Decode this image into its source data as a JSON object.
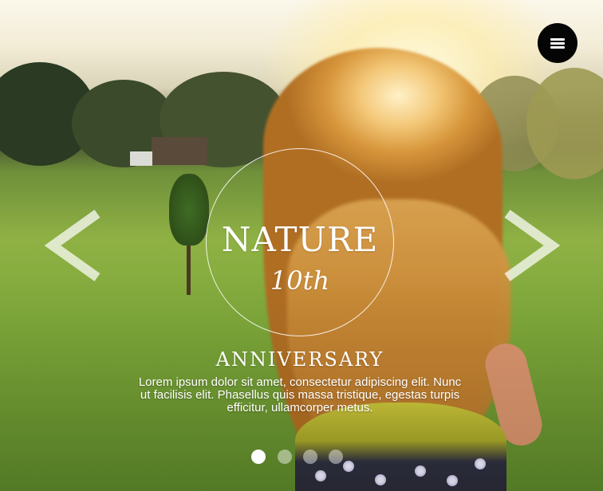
{
  "hero": {
    "title": "NATURE",
    "edition": "10th",
    "subtitle": "ANNIVERSARY",
    "description": "Lorem ipsum dolor sit amet, consectetur adipiscing elit. Nunc ut facilisis elit. Phasellus quis massa tristique, egestas turpis efficitur, ullamcorper metus."
  },
  "menu": {
    "icon": "hamburger-menu-icon"
  },
  "navigation": {
    "prev_icon": "chevron-left-icon",
    "next_icon": "chevron-right-icon"
  },
  "pagination": {
    "total_slides": 4,
    "active_slide": 1
  },
  "colors": {
    "menu_button": "#050505",
    "text": "#ffffff",
    "dot_inactive": "rgba(255,255,255,0.45)",
    "dot_active": "#ffffff"
  }
}
